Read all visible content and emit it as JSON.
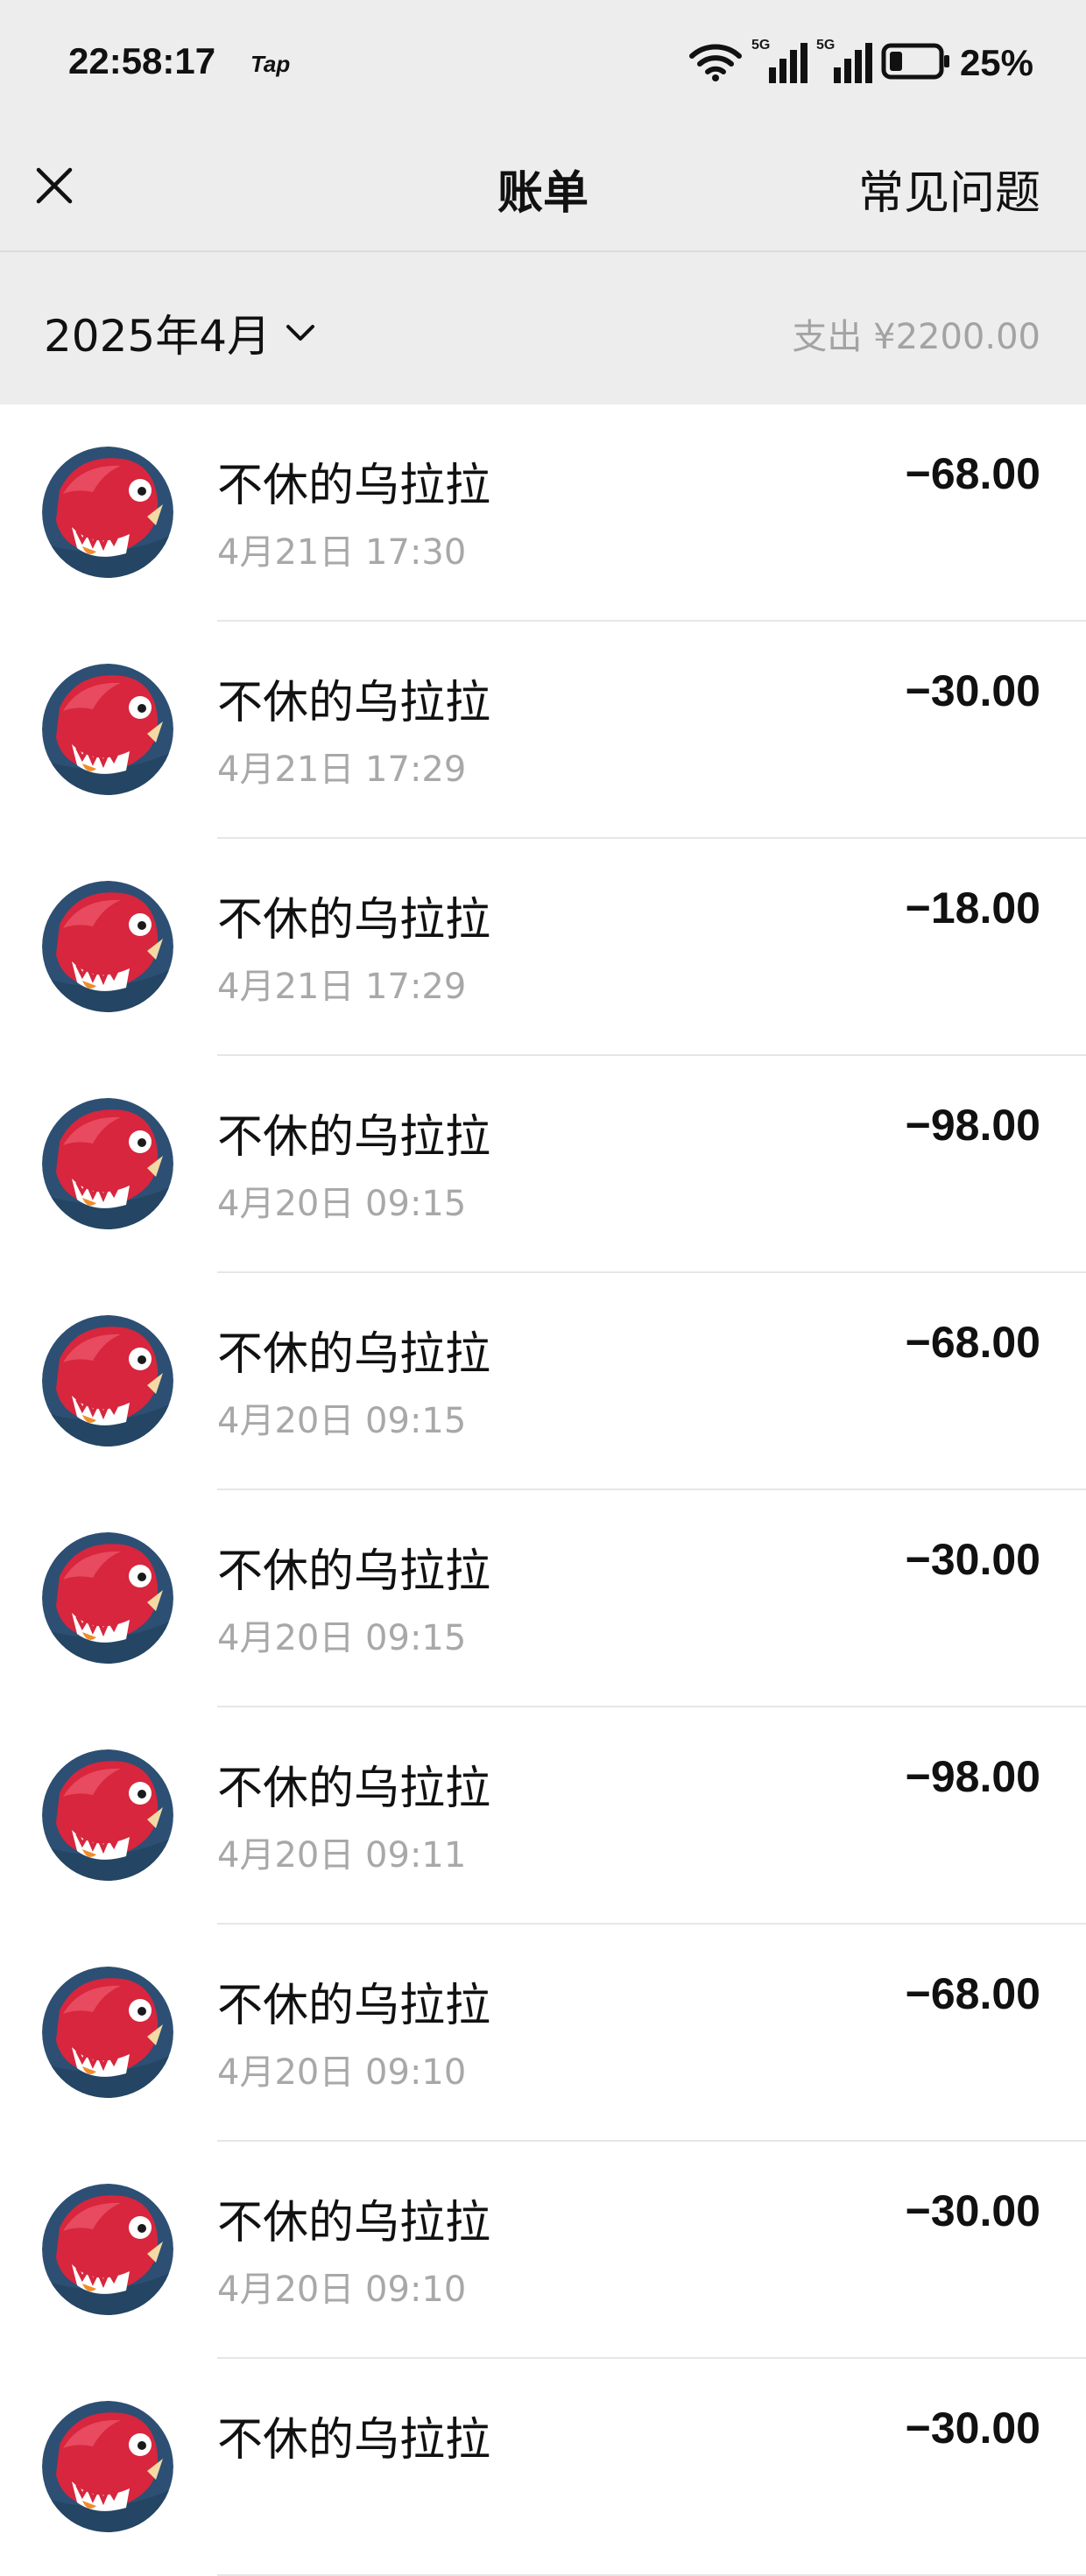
{
  "status": {
    "time": "22:58:17",
    "tap_label": "Tap",
    "network1": "5G",
    "network2": "5G",
    "battery": "25%"
  },
  "nav": {
    "title": "账单",
    "faq": "常见问题"
  },
  "month": {
    "label": "2025年4月",
    "summary": "支出 ¥2200.00"
  },
  "transactions": [
    {
      "name": "不休的乌拉拉",
      "time": "4月21日 17:30",
      "amount": "−68.00"
    },
    {
      "name": "不休的乌拉拉",
      "time": "4月21日 17:29",
      "amount": "−30.00"
    },
    {
      "name": "不休的乌拉拉",
      "time": "4月21日 17:29",
      "amount": "−18.00"
    },
    {
      "name": "不休的乌拉拉",
      "time": "4月20日 09:15",
      "amount": "−98.00"
    },
    {
      "name": "不休的乌拉拉",
      "time": "4月20日 09:15",
      "amount": "−68.00"
    },
    {
      "name": "不休的乌拉拉",
      "time": "4月20日 09:15",
      "amount": "−30.00"
    },
    {
      "name": "不休的乌拉拉",
      "time": "4月20日 09:11",
      "amount": "−98.00"
    },
    {
      "name": "不休的乌拉拉",
      "time": "4月20日 09:10",
      "amount": "−68.00"
    },
    {
      "name": "不休的乌拉拉",
      "time": "4月20日 09:10",
      "amount": "−30.00"
    },
    {
      "name": "不休的乌拉拉",
      "time": "",
      "amount": "−30.00"
    }
  ],
  "colors": {
    "header_bg": "#ededed",
    "list_bg": "#ffffff",
    "secondary_text": "#a8a8a8",
    "avatar_red": "#d7263d",
    "avatar_blue": "#2d4f73"
  },
  "icons": {
    "close": "close-icon",
    "month_chevron": "chevron-down-icon",
    "avatar": "red-dinosaur-avatar"
  }
}
